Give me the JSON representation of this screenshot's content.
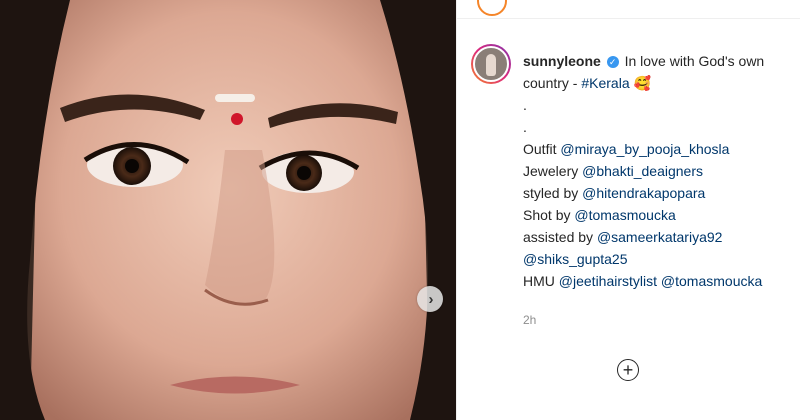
{
  "post": {
    "username": "sunnyleone",
    "caption_first": "In love with God's own",
    "caption_second": "country - ",
    "hashtag": "#Kerala",
    "emoji": "🥰",
    "dot1": ".",
    "dot2": ".",
    "outfit_label": "Outfit ",
    "outfit_handle": "@miraya_by_pooja_khosla",
    "jewelery_label": "Jewelery ",
    "jewelery_handle": "@bhakti_deaigners",
    "styled_label": "styled by ",
    "styled_handle": "@hitendrakapopara",
    "shot_label": "Shot by ",
    "shot_handle": "@tomasmoucka",
    "assisted_label": "assisted by ",
    "assisted_handle": "@sameerkatariya92",
    "assisted_handle2": "@shiks_gupta25",
    "hmu_label": "HMU ",
    "hmu_handle1": "@jeetihairstylist",
    "hmu_handle2": "@tomasmoucka",
    "timestamp": "2h"
  },
  "icons": {
    "verified": "verified-badge-icon",
    "next": "chevron-right-icon",
    "add": "plus-circle-icon"
  },
  "colors": {
    "link": "#00376b",
    "verified": "#3897f0",
    "story_ring": "#dd2a7b"
  }
}
